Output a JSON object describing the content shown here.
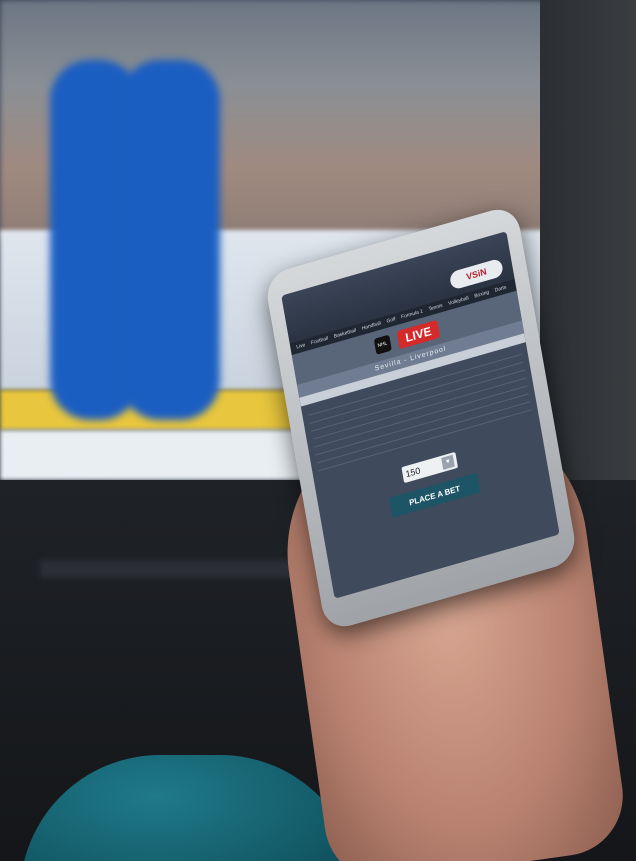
{
  "screen": {
    "broadcast_logo": "VSiN",
    "nav_items": [
      "Live",
      "Football",
      "Basketball",
      "Handball",
      "Golf",
      "Formula 1",
      "Tennis",
      "Volleyball",
      "Boxing",
      "Darts"
    ],
    "league_logo": "NHL",
    "live_label": "LIVE",
    "match_home": "Sevilla",
    "match_separator": "-",
    "match_away": "Liverpool",
    "stake_value": "150",
    "place_bet_label": "PLACE A BET"
  },
  "colors": {
    "live_red": "#d42a2a",
    "bet_button": "#1d5566",
    "jersey_blue": "#1b5ec1"
  }
}
